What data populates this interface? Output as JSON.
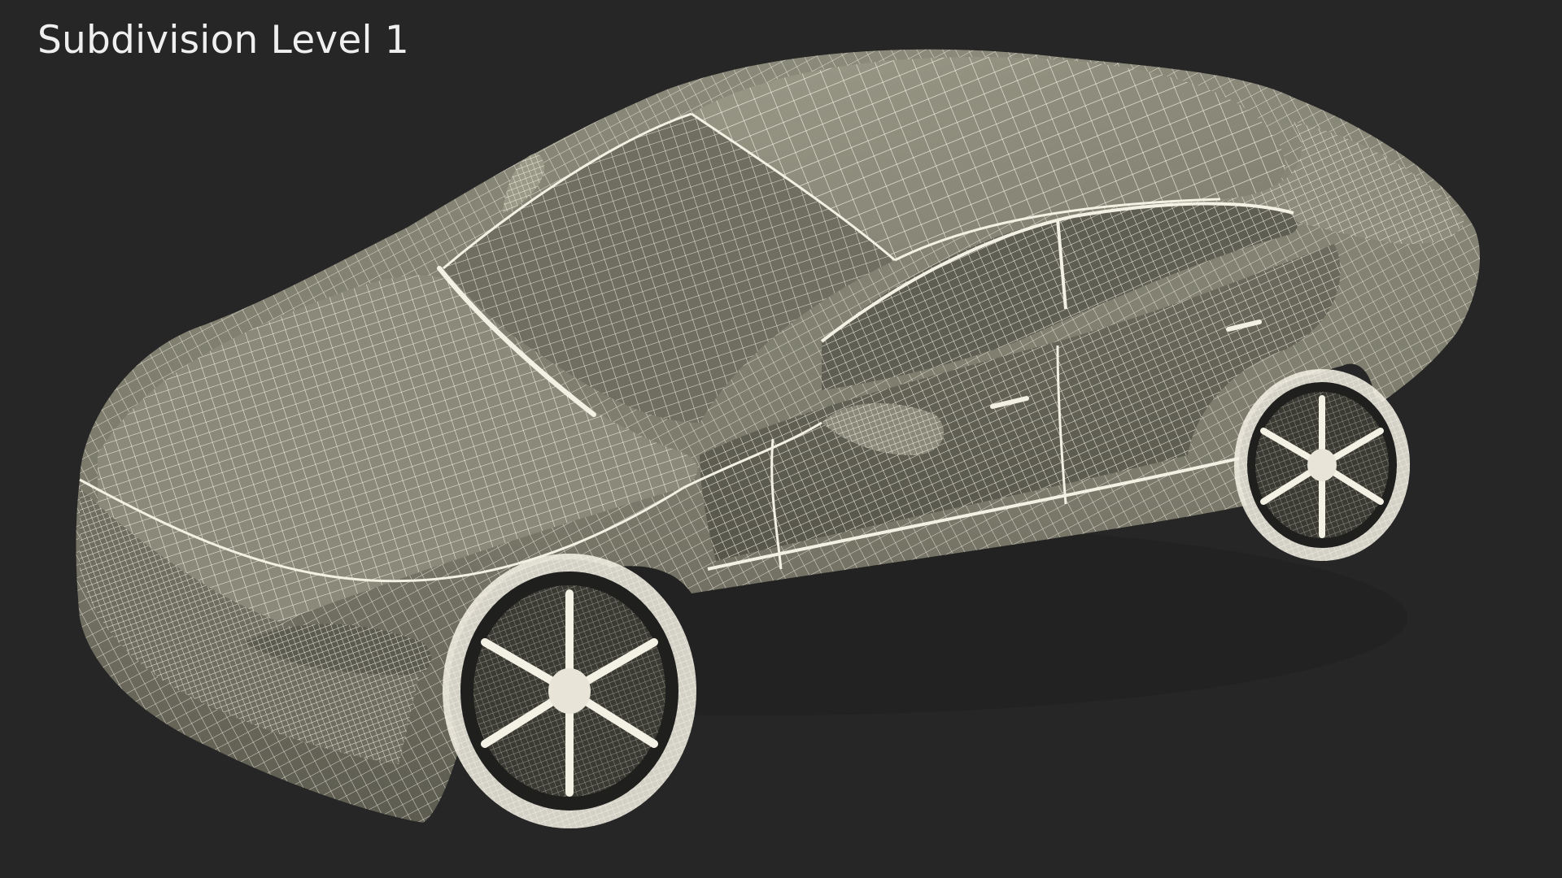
{
  "caption": "Subdivision Level 1",
  "colors": {
    "background": "#262626",
    "caption": "#efefef",
    "surface": "#7c7b6c",
    "surface_light": "#989786",
    "surface_dark": "#565549",
    "wire": "#f3f0e4",
    "rim_core": "#3a3a33"
  }
}
